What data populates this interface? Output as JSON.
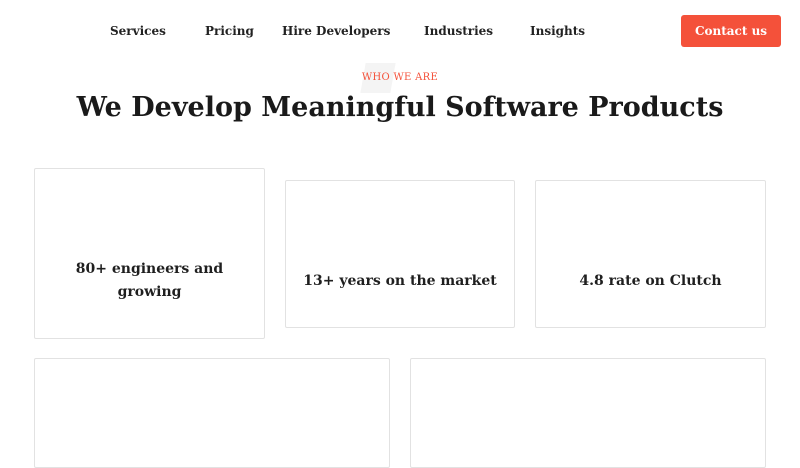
{
  "nav": {
    "items": [
      "Services",
      "Pricing",
      "Hire Developers",
      "Industries",
      "Insights"
    ],
    "contact_label": "Contact us"
  },
  "hero": {
    "eyebrow": "WHO WE ARE",
    "title": "We Develop Meaningful Software Products"
  },
  "stats": [
    {
      "label": "80+ engineers and growing"
    },
    {
      "label": "13+ years on the market"
    },
    {
      "label": "4.8 rate on Clutch"
    }
  ],
  "colors": {
    "accent": "#f4513a",
    "text": "#1f1f1f",
    "card_border": "#e2e2e2"
  }
}
